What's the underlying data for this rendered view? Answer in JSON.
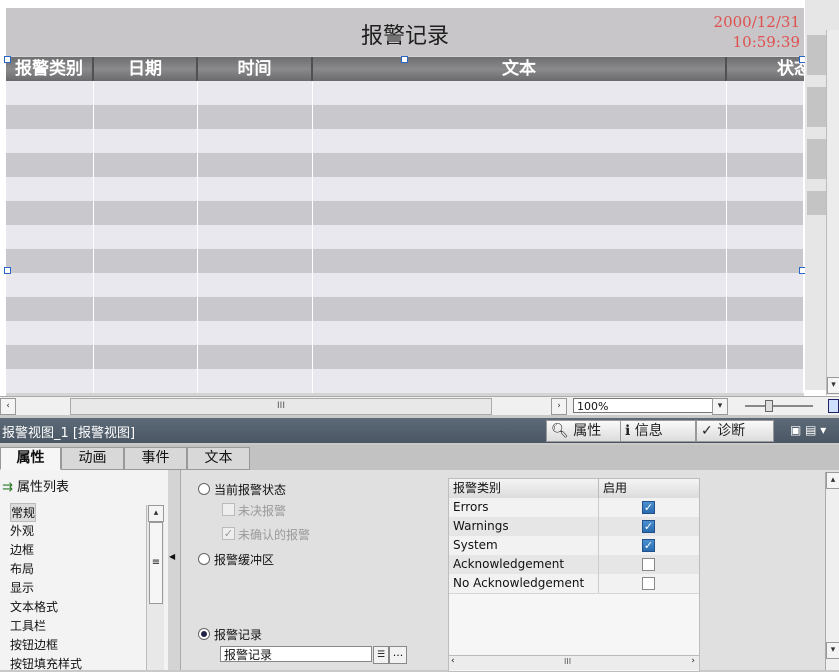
{
  "alarm_view": {
    "title": "报警记录",
    "date": "2000/12/31",
    "time": "10:59:39",
    "columns": [
      "报警类别",
      "日期",
      "时间",
      "文本",
      "状态"
    ],
    "row_count": 13
  },
  "canvas_footer": {
    "zoom": "100%",
    "scroll_grip": "III"
  },
  "inspector": {
    "title": "报警视图_1 [报警视图]",
    "panes": [
      "属性",
      "信息",
      "诊断"
    ]
  },
  "tabs": [
    "属性",
    "动画",
    "事件",
    "文本"
  ],
  "left_nav": {
    "header": "属性列表",
    "items": [
      "常规",
      "外观",
      "边框",
      "布局",
      "显示",
      "文本格式",
      "工具栏",
      "按钮边框",
      "按钮填充样式"
    ]
  },
  "options": {
    "current_state": "当前报警状态",
    "unresolved": "未决报警",
    "unacknowledged": "未确认的报警",
    "buffer": "报警缓冲区",
    "log": "报警记录",
    "log_value": "报警记录",
    "browse": "..."
  },
  "class_table": {
    "headers": [
      "报警类别",
      "启用"
    ],
    "rows": [
      {
        "name": "Errors",
        "enabled": true
      },
      {
        "name": "Warnings",
        "enabled": true
      },
      {
        "name": "System",
        "enabled": true
      },
      {
        "name": "Acknowledgement",
        "enabled": false
      },
      {
        "name": "No Acknowledgement",
        "enabled": false
      }
    ],
    "scroll_grip": "III"
  }
}
